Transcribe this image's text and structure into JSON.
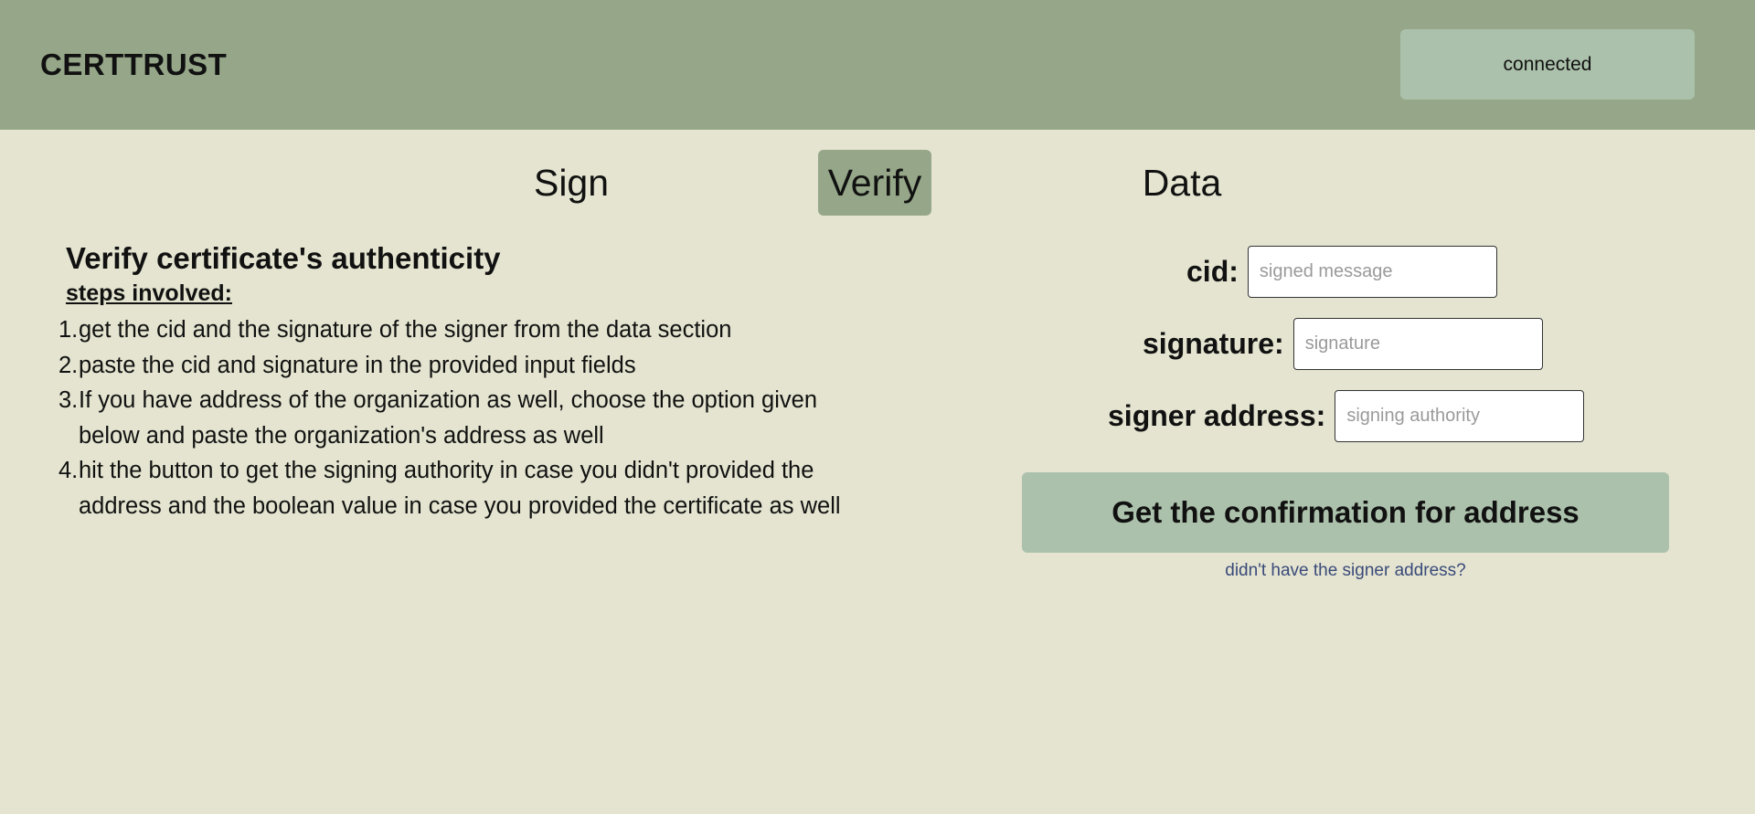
{
  "header": {
    "brand": "CERTTRUST",
    "status_label": "connected"
  },
  "tabs": [
    {
      "label": "Sign",
      "active": false
    },
    {
      "label": "Verify",
      "active": true
    },
    {
      "label": "Data",
      "active": false
    }
  ],
  "instructions": {
    "title": "Verify certificate's authenticity",
    "steps_label": "steps involved:",
    "steps": [
      {
        "num": "1.",
        "text": "get the cid and the signature of the signer from the data section"
      },
      {
        "num": "2.",
        "text": "paste the cid and signature in the provided input fields"
      },
      {
        "num": "3.",
        "text": "If you have address of the organization as well, choose the option given below and paste the organization's address as well"
      },
      {
        "num": "4.",
        "text": "hit the button to get the signing authority in case you didn't provided the address and the boolean value in case you provided the certificate as well"
      }
    ]
  },
  "form": {
    "cid_label": "cid:",
    "cid_placeholder": "signed message",
    "cid_value": "",
    "signature_label": "signature:",
    "signature_placeholder": "signature",
    "signature_value": "",
    "address_label": "signer address:",
    "address_placeholder": "signing authority",
    "address_value": "",
    "submit_label": "Get the confirmation for address",
    "no_address_link": "didn't have the signer address?"
  },
  "colors": {
    "header_bg": "#95a788",
    "page_bg": "#e4e4d0",
    "button_bg": "#abc1ab",
    "active_tab_bg": "#95a788",
    "link": "#3a4a7a"
  }
}
